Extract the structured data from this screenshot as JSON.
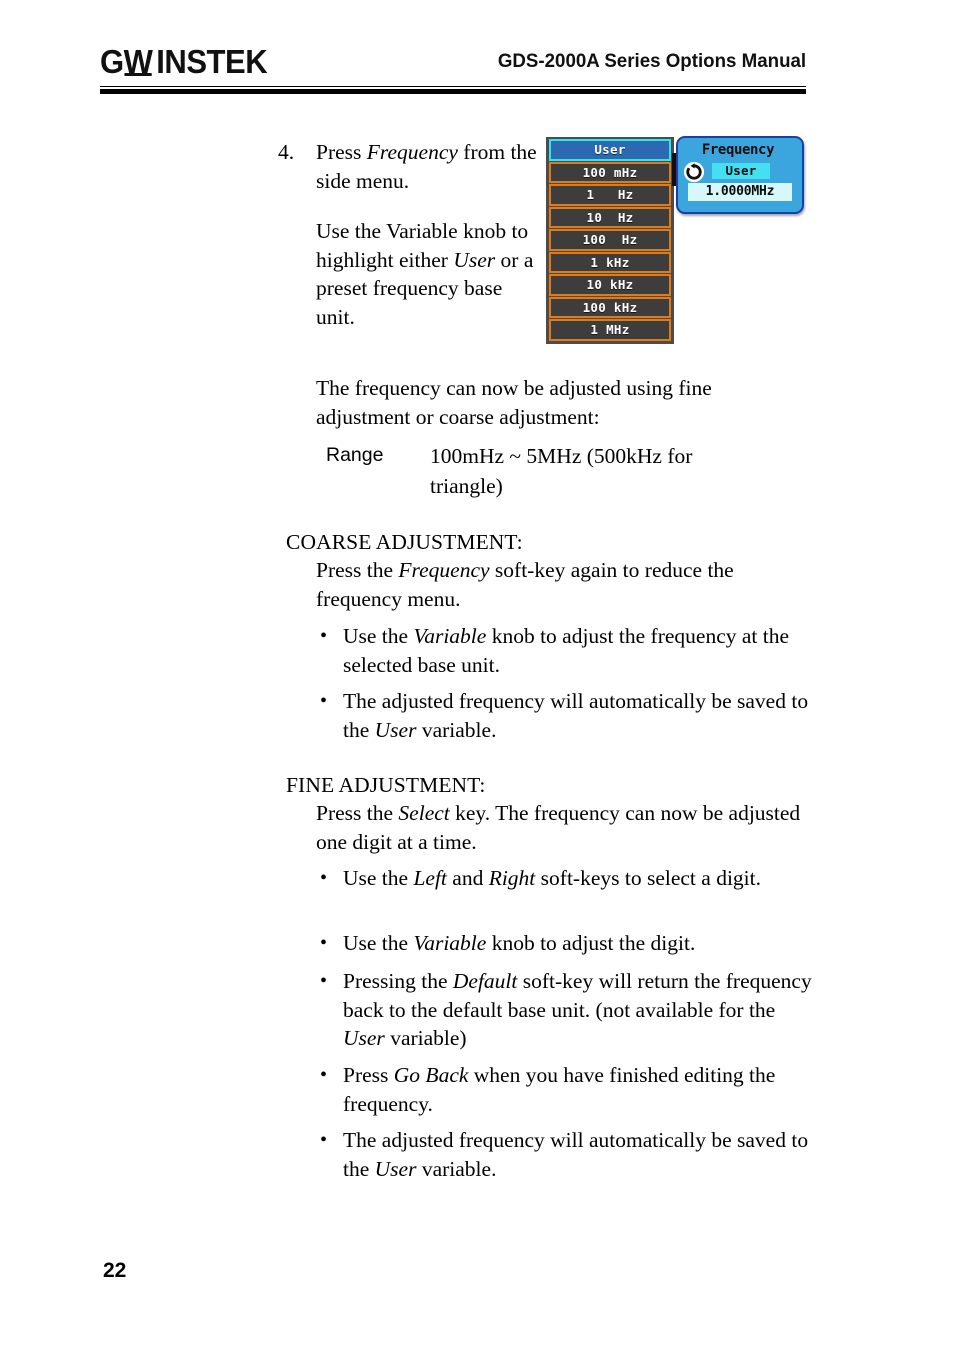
{
  "header": {
    "logo_gw": "G",
    "logo_w": "W",
    "logo_instek": "INSTEK",
    "title": "GDS-2000A Series Options Manual"
  },
  "page_number": "22",
  "step": {
    "number": "4.",
    "line1_pre": "Press ",
    "line1_italic": "Frequency",
    "line1_post": " from the side menu.",
    "para2_pre": "Use the Variable knob to highlight either ",
    "para2_italic": "User",
    "para2_post": " or a preset frequency base unit."
  },
  "intro_paragraph": "The frequency can now be adjusted using fine adjustment or coarse adjustment:",
  "range": {
    "label": "Range",
    "value": "100mHz ~ 5MHz (500kHz for triangle)"
  },
  "coarse": {
    "heading": "COARSE ADJUSTMENT:",
    "para_pre": "Press the ",
    "para_italic": "Frequency",
    "para_post": " soft-key again to reduce the frequency menu.",
    "bullets": [
      {
        "dot": "•",
        "pre": "Use the ",
        "italic": "Variable",
        "post": " knob to adjust the frequency at the selected base unit."
      },
      {
        "dot": "•",
        "pre": "The adjusted frequency will automatically be saved to the ",
        "italic": "User",
        "post": " variable."
      }
    ]
  },
  "fine": {
    "heading": "FINE ADJUSTMENT:",
    "para_pre": "Press the ",
    "para_italic": "Select",
    "para_post": " key. The frequency can now be adjusted one digit at a time.",
    "bullets": [
      {
        "dot": "•",
        "pre": "Use the ",
        "italic": "Left",
        "mid": " and ",
        "italic2": "Right",
        "post": " soft-keys to select a digit."
      },
      {
        "dot": "•",
        "pre": "Use the ",
        "italic": "Variable",
        "post": " knob to adjust the digit."
      },
      {
        "dot": "•",
        "pre": "Pressing the ",
        "italic": "Default",
        "mid": " soft-key will return the frequency back to the default base unit. (not available for the ",
        "italic2": "User",
        "post": " variable)"
      },
      {
        "dot": "•",
        "pre": "Press ",
        "italic": "Go Back",
        "post": " when you have finished editing the frequency."
      },
      {
        "dot": "•",
        "pre": "The adjusted frequency will automatically be saved to the ",
        "italic": "User",
        "post": " variable."
      }
    ]
  },
  "scope_screenshot": {
    "base_unit_menu": {
      "selected_index": 0,
      "items": [
        {
          "label": "User",
          "selected": true
        },
        {
          "label": "100 mHz",
          "selected": false
        },
        {
          "label": "1   Hz",
          "selected": false
        },
        {
          "label": "10  Hz",
          "selected": false
        },
        {
          "label": "100  Hz",
          "selected": false
        },
        {
          "label": "1 kHz",
          "selected": false
        },
        {
          "label": "10 kHz",
          "selected": false
        },
        {
          "label": "100 kHz",
          "selected": false
        },
        {
          "label": "1 MHz",
          "selected": false
        }
      ],
      "colors": {
        "panel_bg": "#4c4c4c",
        "item_bg": "#3d3d3d",
        "item_border": "#e07b16",
        "selected_bg": "#2d69b0",
        "selected_border": "#2ee6ef",
        "text": "#ffffff"
      }
    },
    "frequency_popup": {
      "title": "Frequency",
      "variable_label": "User",
      "value": "1.0000MHz",
      "icon": "rotary-knob-icon",
      "colors": {
        "popup_bg": "#3ba6dd",
        "popup_border": "#1b3fa8",
        "highlight_bg": "#44e0f2",
        "value_bg": "#d8f7fa"
      }
    }
  }
}
